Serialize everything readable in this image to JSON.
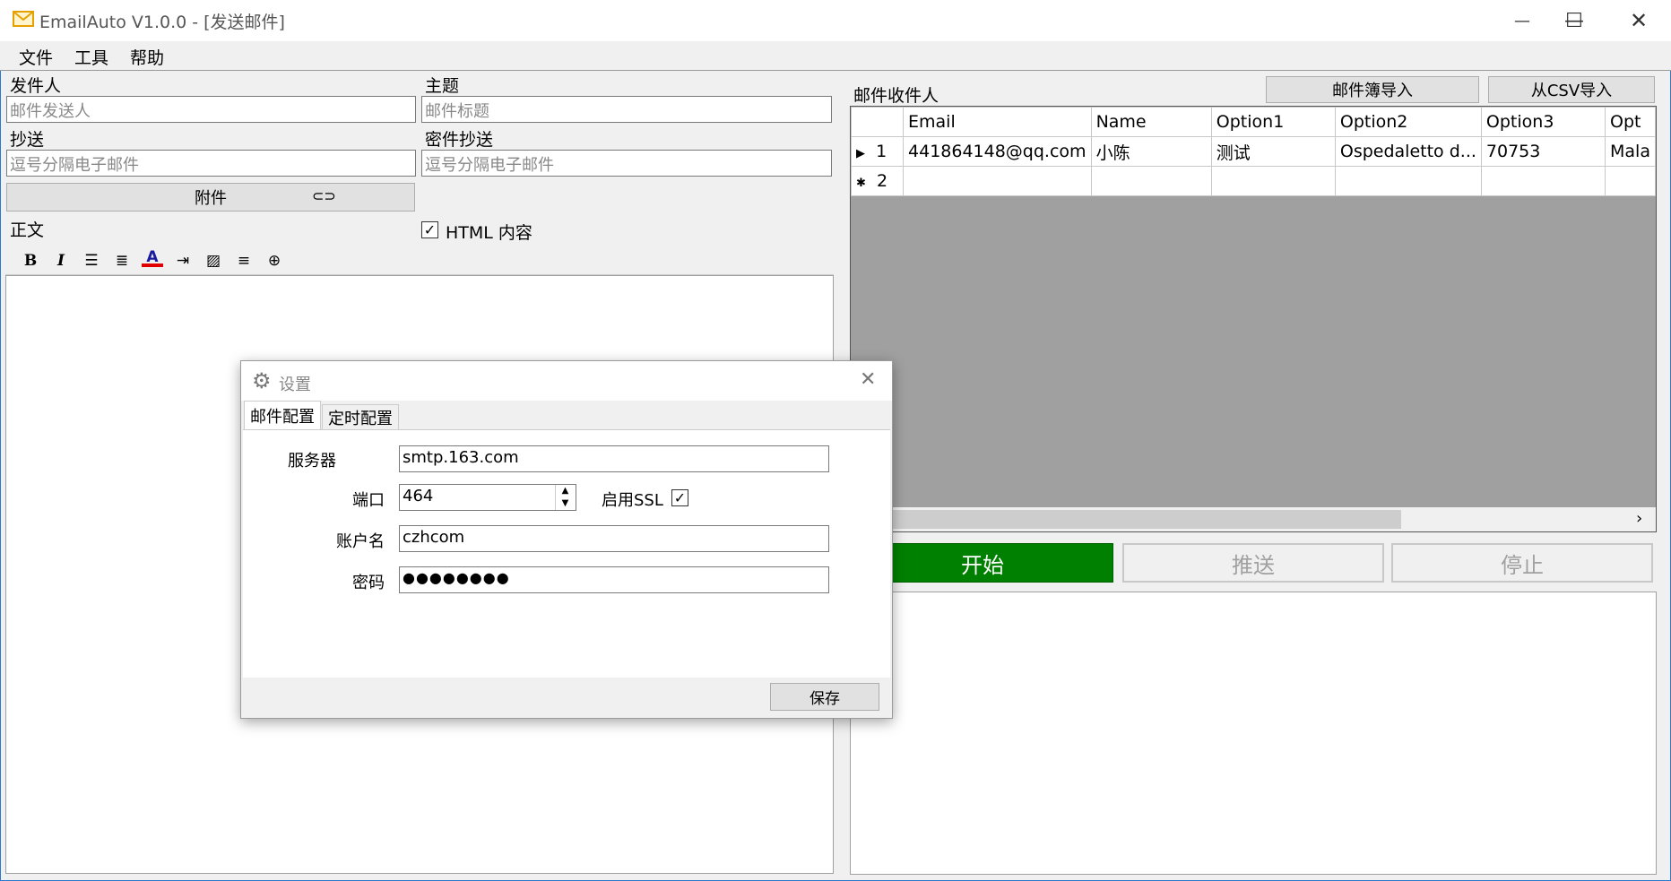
{
  "window": {
    "title": "EmailAuto V1.0.0 - [发送邮件]"
  },
  "menu": [
    "文件",
    "工具",
    "帮助"
  ],
  "compose": {
    "sender_label": "发件人",
    "sender_placeholder": "邮件发送人",
    "subject_label": "主题",
    "subject_placeholder": "邮件标题",
    "cc_label": "抄送",
    "cc_placeholder": "逗号分隔电子邮件",
    "bcc_label": "密件抄送",
    "bcc_placeholder": "逗号分隔电子邮件",
    "attach_label": "附件",
    "body_label": "正文",
    "html_label": "HTML 内容",
    "html_checked": true
  },
  "toolbar_icons": [
    "bold-icon",
    "italic-icon",
    "bullet-list-icon",
    "justify-icon",
    "font-color-icon",
    "indent-icon",
    "image-icon",
    "align-icon",
    "globe-icon"
  ],
  "recipients": {
    "label": "邮件收件人",
    "import_book": "邮件簿导入",
    "import_csv": "从CSV导入",
    "columns": [
      "Email",
      "Name",
      "Option1",
      "Option2",
      "Option3",
      "Opt"
    ],
    "rows": [
      {
        "num": "1",
        "cells": [
          "441864148@qq.com",
          "小陈",
          "测试",
          "Ospedaletto d...",
          "70753",
          "Mala"
        ]
      },
      {
        "num": "2",
        "cells": [
          "",
          "",
          "",
          "",
          "",
          ""
        ]
      }
    ]
  },
  "actions": {
    "start": "开始",
    "push": "推送",
    "stop": "停止"
  },
  "colors": {
    "start_bg": "#008000",
    "title_border": "#2b79d0"
  },
  "dialog": {
    "title": "设置",
    "tabs": [
      "邮件配置",
      "定时配置"
    ],
    "server_label": "服务器",
    "server_value": "smtp.163.com",
    "port_label": "端口",
    "port_value": "464",
    "ssl_label": "启用SSL",
    "ssl_checked": true,
    "account_label": "账户名",
    "account_value": "czhcom",
    "password_label": "密码",
    "password_value": "●●●●●●●●",
    "save_label": "保存"
  }
}
